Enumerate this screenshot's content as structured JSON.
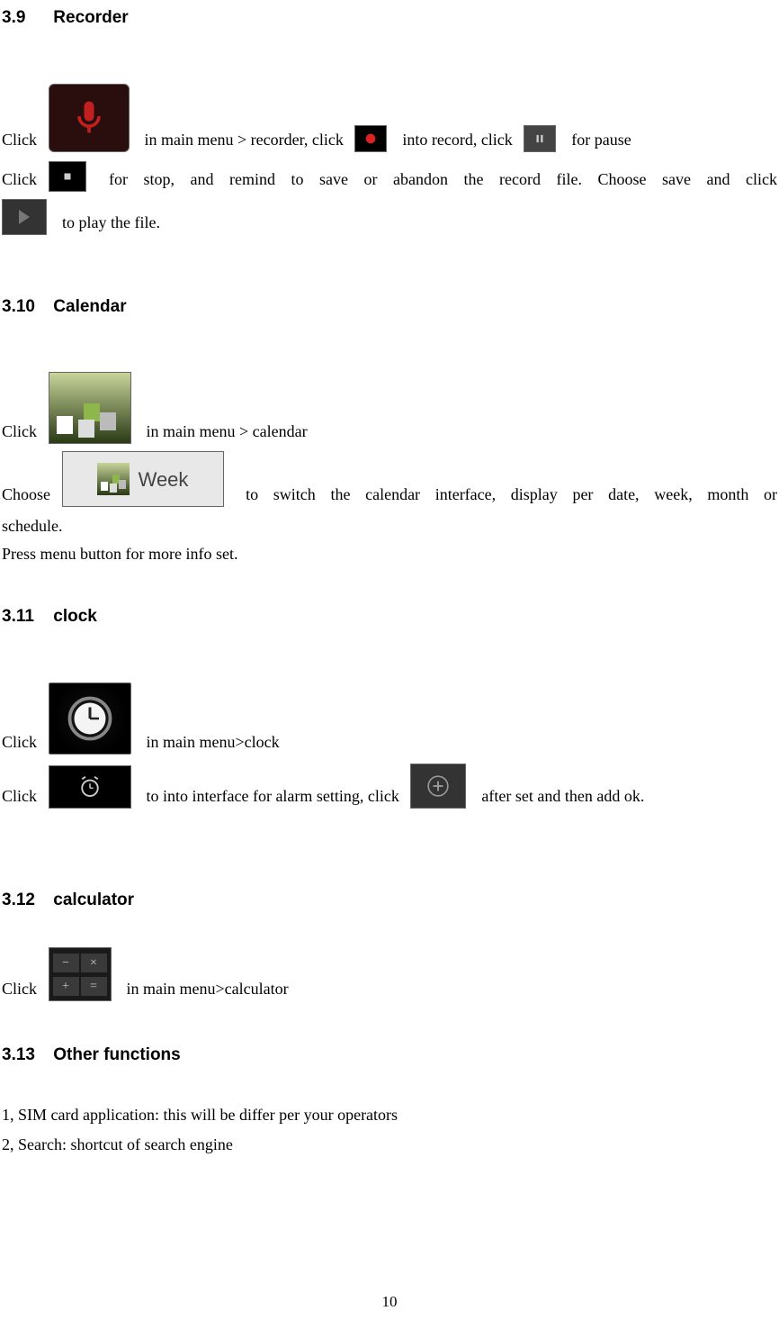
{
  "sections": {
    "s39": {
      "num": "3.9",
      "title": "Recorder"
    },
    "s310": {
      "num": "3.10",
      "title": "Calendar"
    },
    "s311": {
      "num": "3.11",
      "title": "clock"
    },
    "s312": {
      "num": "3.12",
      "title": "calculator"
    },
    "s313": {
      "num": "3.13",
      "title": "Other functions"
    }
  },
  "recorder": {
    "p1a": "Click ",
    "p1b": "  in main menu > recorder, click ",
    "p1c": "  into record, click ",
    "p1d": "  for pause",
    "p2a": "Click ",
    "p2b": " for stop, and remind to save or abandon the record file. Choose save and click",
    "p3a": "  to play the file."
  },
  "calendar": {
    "p1a": "Click ",
    "p1b": "  in main menu > calendar",
    "p2a": "Choose ",
    "p2b": " to switch the calendar interface, display per date, week, month or",
    "p3": "schedule.",
    "p4": "Press menu button for more info set.",
    "week_label": "Week"
  },
  "clock": {
    "p1a": "Click ",
    "p1b": "  in main menu>clock",
    "p2a": "Click ",
    "p2b": "  to into interface for alarm setting, click ",
    "p2c": "  after set and then add ok."
  },
  "calculator": {
    "p1a": "Click ",
    "p1b": "  in main menu>calculator"
  },
  "other": {
    "l1": "1, SIM card application: this will be differ per your operators",
    "l2": "2, Search: shortcut of search engine"
  },
  "page_number": "10"
}
